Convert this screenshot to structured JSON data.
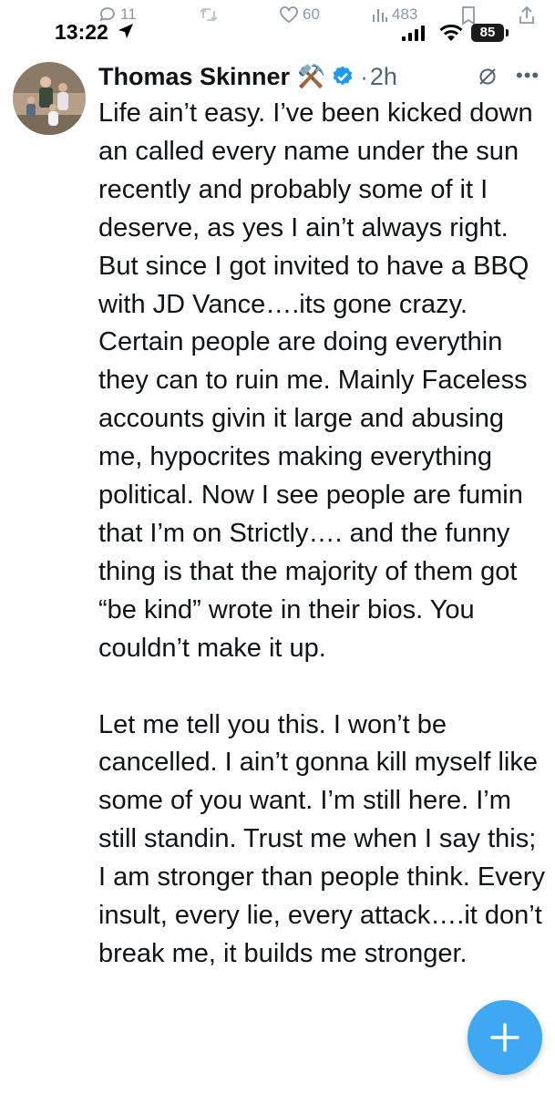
{
  "status_bar": {
    "time": "13:22",
    "battery": "85"
  },
  "ghost_actions": {
    "replies": "11",
    "likes": "60",
    "views": "483"
  },
  "tweet": {
    "author_name": "Thomas Skinner",
    "author_emoji": "⚒️",
    "time_ago": "2h",
    "body": "Life ain’t easy. I’ve been kicked down an called every name under the sun recently and probably some of it I deserve, as yes I ain’t always right.  But since I got invited to have a BBQ with JD Vance….its gone crazy. Certain people are doing everythin they can to ruin me. Mainly Faceless accounts givin it large and abusing me, hypocrites making everything political. Now I see people are fumin that I’m on Strictly…. and the funny thing is that the majority of them got “be kind” wrote in their bios. You couldn’t make it up.\n\nLet me tell you this. I won’t be cancelled. I ain’t gonna kill myself like some of you want. I’m still here. I’m still standin. Trust me when I say this; I am stronger than people think. Every insult, every lie, every attack….it don’t break me, it builds me stronger."
  },
  "colors": {
    "accent": "#1d9bf0",
    "text": "#0f1419",
    "secondary": "#536471"
  },
  "icons": {
    "verified": "verified-badge-icon",
    "grok": "grok-icon",
    "more": "more-icon",
    "compose": "plus-icon"
  }
}
